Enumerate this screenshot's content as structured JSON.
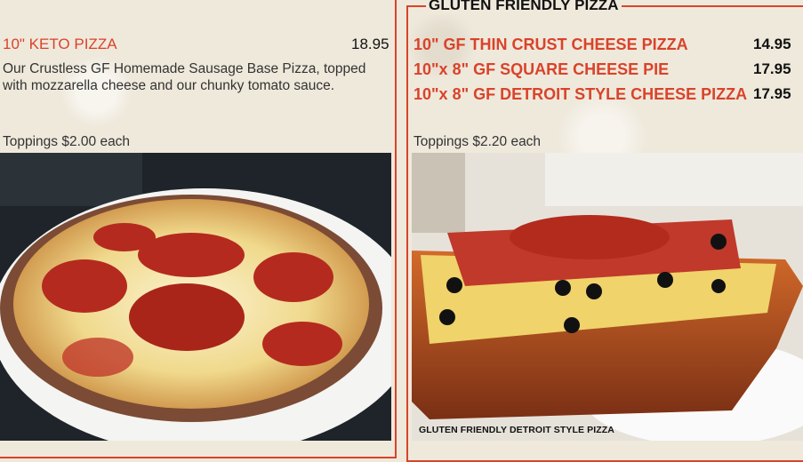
{
  "left": {
    "item_title": "10\" KETO PIZZA",
    "item_price": "18.95",
    "description": "Our Crustless GF Homemade Sausage Base Pizza, topped with mozzarella cheese and our chunky tomato sauce.",
    "toppings": "Toppings $2.00 each"
  },
  "right": {
    "section_title": "GLUTEN FRIENDLY PIZZA",
    "items": [
      {
        "title": "10\" GF THIN CRUST CHEESE PIZZA",
        "price": "14.95"
      },
      {
        "title": "10\"x 8\" GF SQUARE CHEESE PIE",
        "price": "17.95"
      },
      {
        "title": "10\"x 8\" GF DETROIT STYLE CHEESE PIZZA",
        "price": "17.95"
      }
    ],
    "toppings": "Toppings $2.20 each",
    "photo_caption": "GLUTEN FRIENDLY DETROIT STYLE PIZZA"
  },
  "colors": {
    "accent": "#d9432a",
    "background": "#efe9dc",
    "text": "#333333"
  }
}
